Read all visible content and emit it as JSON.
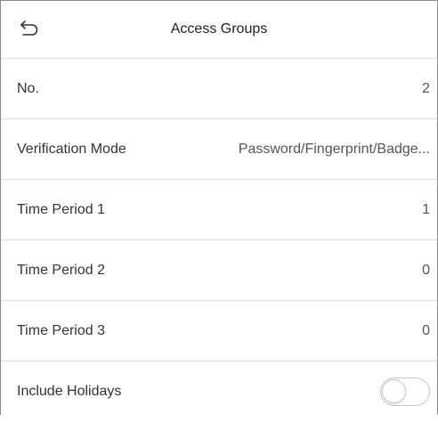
{
  "header": {
    "title": "Access Groups",
    "back_icon": "return-arrow-icon"
  },
  "rows": [
    {
      "label": "No.",
      "value": "2"
    },
    {
      "label": "Verification Mode",
      "value": "Password/Fingerprint/Badge..."
    },
    {
      "label": "Time Period 1",
      "value": "1"
    },
    {
      "label": "Time Period 2",
      "value": "0"
    },
    {
      "label": "Time Period 3",
      "value": "0"
    }
  ],
  "holidays": {
    "label": "Include Holidays",
    "enabled": false
  }
}
